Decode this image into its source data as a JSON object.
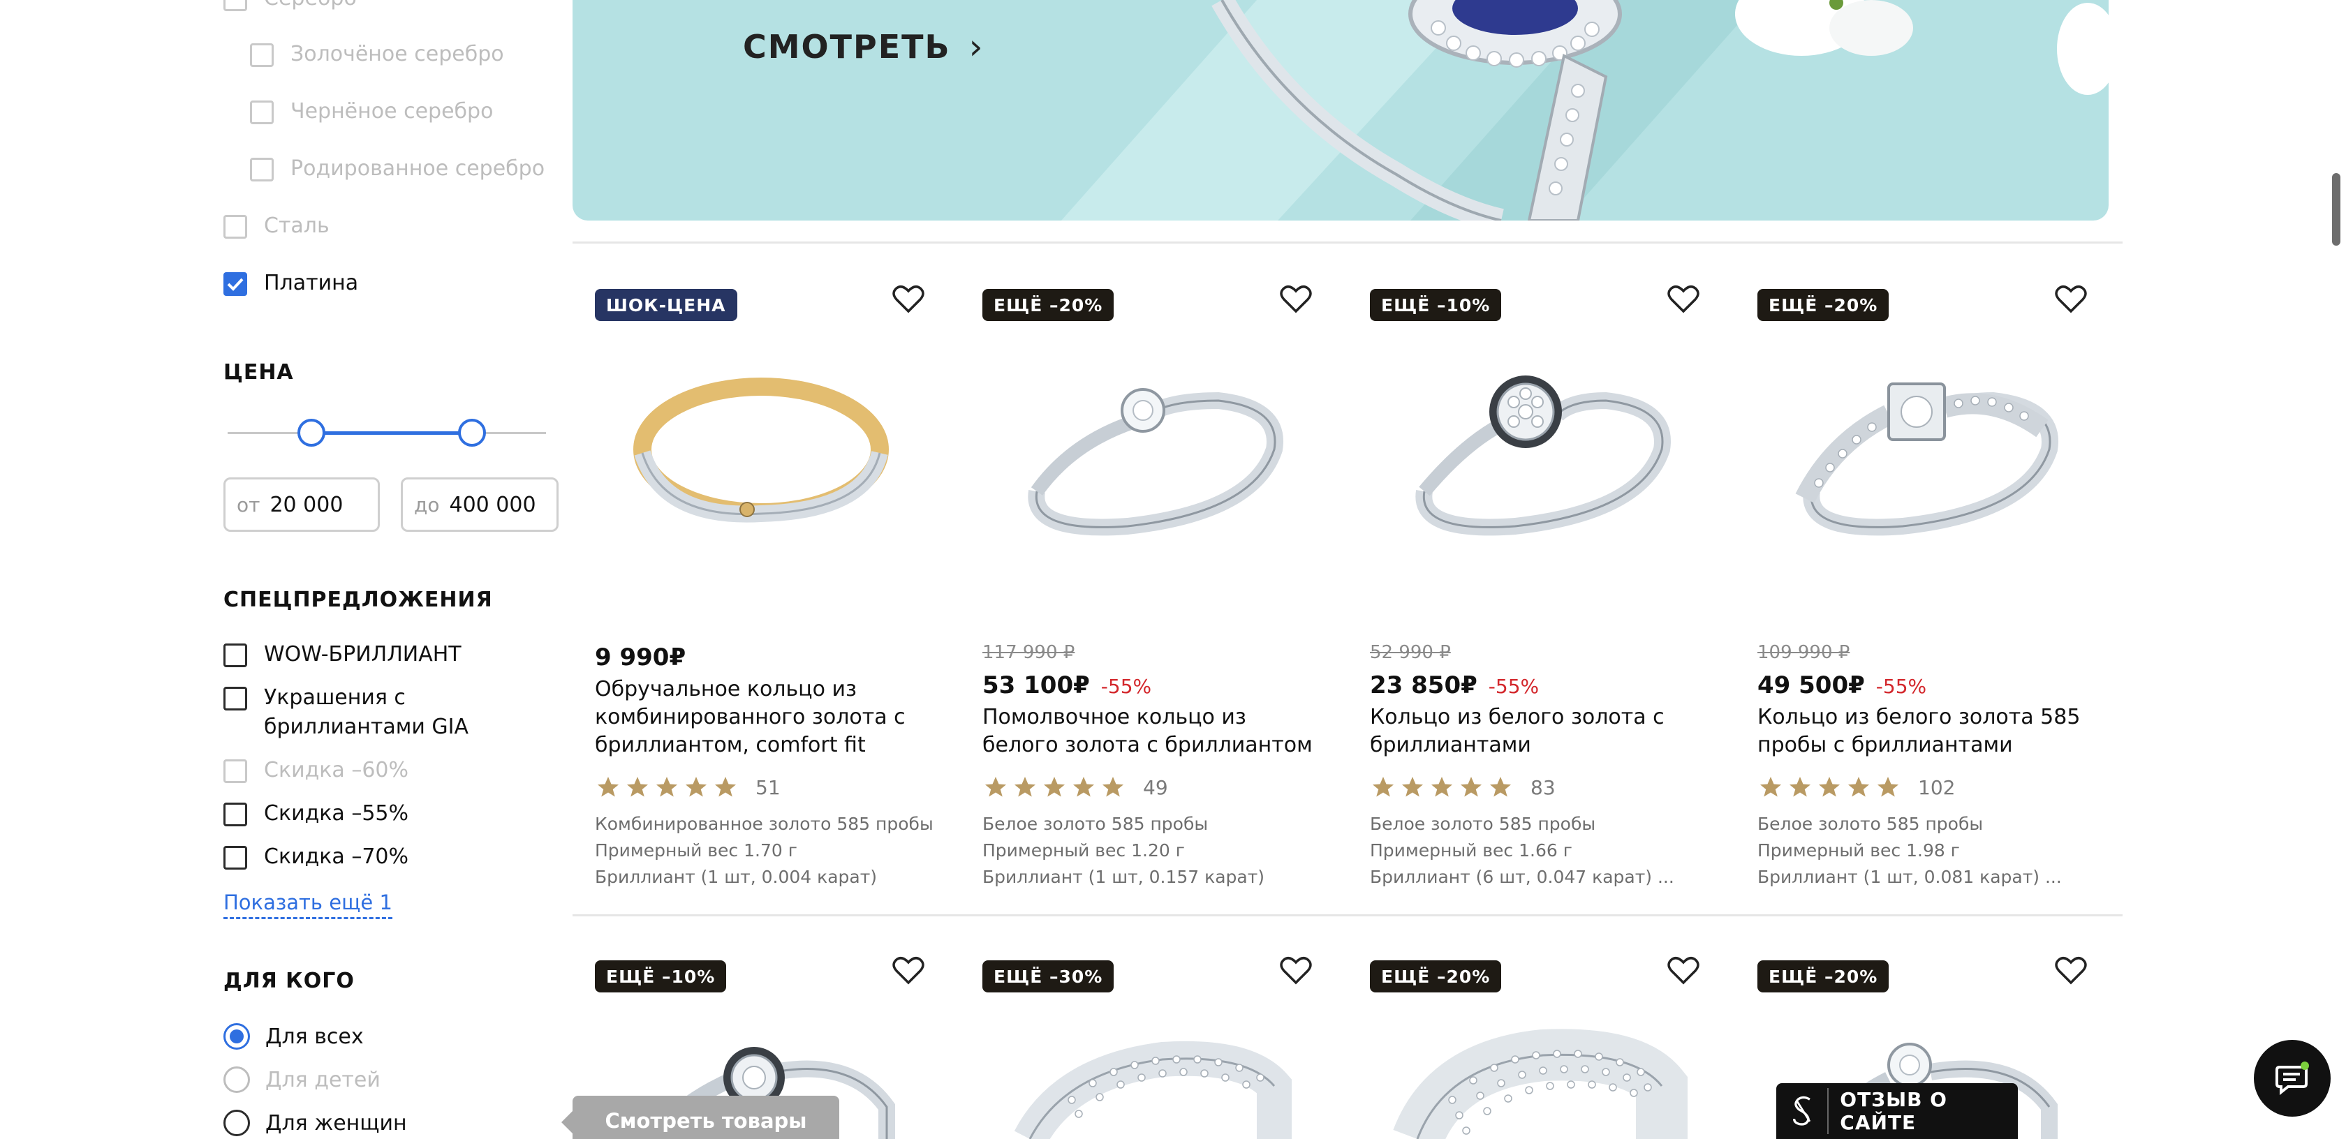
{
  "filters": {
    "metals": [
      {
        "label": "Серебро",
        "checked": false,
        "disabled": true,
        "indent": false
      },
      {
        "label": "Золочёное серебро",
        "checked": false,
        "disabled": true,
        "indent": true
      },
      {
        "label": "Чернёное серебро",
        "checked": false,
        "disabled": true,
        "indent": true
      },
      {
        "label": "Родированное серебро",
        "checked": false,
        "disabled": true,
        "indent": true
      },
      {
        "label": "Сталь",
        "checked": false,
        "disabled": true,
        "indent": false
      },
      {
        "label": "Платина",
        "checked": true,
        "disabled": false,
        "indent": false
      }
    ],
    "price": {
      "title": "ЦЕНА",
      "from_prefix": "от",
      "from_value": "20 000",
      "to_prefix": "до",
      "to_value": "400 000"
    },
    "specials": {
      "title": "СПЕЦПРЕДЛОЖЕНИЯ",
      "items": [
        {
          "label": "WOW-БРИЛЛИАНТ",
          "checked": false,
          "disabled": false
        },
        {
          "label": "Украшения с бриллиантами GIA",
          "checked": false,
          "disabled": false
        },
        {
          "label": "Скидка –60%",
          "checked": false,
          "disabled": true
        },
        {
          "label": "Скидка –55%",
          "checked": false,
          "disabled": false
        },
        {
          "label": "Скидка –70%",
          "checked": false,
          "disabled": false
        }
      ],
      "show_more": "Показать ещё 1"
    },
    "for_whom": {
      "title": "ДЛЯ КОГО",
      "options": [
        {
          "label": "Для всех",
          "selected": true,
          "disabled": false
        },
        {
          "label": "Для детей",
          "selected": false,
          "disabled": true
        },
        {
          "label": "Для женщин",
          "selected": false,
          "disabled": false
        }
      ]
    }
  },
  "banner": {
    "cta_label": "СМОТРЕТЬ",
    "chevron": "›"
  },
  "products_row1": [
    {
      "badge": "ШОК-ЦЕНА",
      "badge_type": "shock",
      "old_price": "",
      "price": "9 990₽",
      "discount": "",
      "name": "Обручальное кольцо из комбинированного золота с бриллиантом, comfort fit",
      "rating": 5,
      "reviews": "51",
      "spec1": "Комбинированное золото 585 пробы",
      "spec2": "Примерный вес 1.70 г",
      "spec3": "Бриллиант (1 шт, 0.004 карат)",
      "ring": "gold-band"
    },
    {
      "badge": "ЕЩЁ –20%",
      "badge_type": "extra",
      "old_price": "117 990 ₽",
      "price": "53 100₽",
      "discount": "-55%",
      "name": "Помолвочное кольцо из белого золота с бриллиантом",
      "rating": 5,
      "reviews": "49",
      "spec1": "Белое золото 585 пробы",
      "spec2": "Примерный вес 1.20 г",
      "spec3": "Бриллиант (1 шт, 0.157 карат)",
      "ring": "solitaire"
    },
    {
      "badge": "ЕЩЁ –10%",
      "badge_type": "extra",
      "old_price": "52 990 ₽",
      "price": "23 850₽",
      "discount": "-55%",
      "name": "Кольцо из белого золота с бриллиантами",
      "rating": 5,
      "reviews": "83",
      "spec1": "Белое золото 585 пробы",
      "spec2": "Примерный вес 1.66 г",
      "spec3": "Бриллиант (6 шт, 0.047 карат) ...",
      "ring": "cluster"
    },
    {
      "badge": "ЕЩЁ –20%",
      "badge_type": "extra",
      "old_price": "109 990 ₽",
      "price": "49 500₽",
      "discount": "-55%",
      "name": "Кольцо из белого золота 585 пробы с бриллиантами",
      "rating": 5,
      "reviews": "102",
      "spec1": "Белое золото 585 пробы",
      "spec2": "Примерный вес 1.98 г",
      "spec3": "Бриллиант (1 шт, 0.081 карат) ...",
      "ring": "pave-shoulder"
    }
  ],
  "products_row2": [
    {
      "badge": "ЕЩЁ –10%",
      "badge_type": "extra"
    },
    {
      "badge": "ЕЩЁ –30%",
      "badge_type": "extra"
    },
    {
      "badge": "ЕЩЁ –20%",
      "badge_type": "extra"
    },
    {
      "badge": "ЕЩЁ –20%",
      "badge_type": "extra"
    }
  ],
  "widgets": {
    "view_goods": "Смотреть товары",
    "site_review": "ОТЗЫВ О САЙТЕ",
    "icons": [
      "heart-icon",
      "star-icon",
      "chat-icon",
      "chevron-right-icon",
      "checkmark-icon"
    ]
  },
  "colors": {
    "accent": "#2f6fe0",
    "discount": "#d3262b",
    "star": "#b99a63",
    "badge_shock": "#273563",
    "badge_extra": "#1e1a14",
    "banner_bg": "#b5e1e3"
  }
}
